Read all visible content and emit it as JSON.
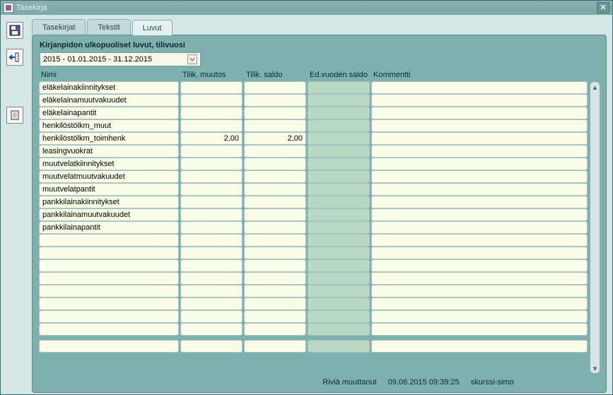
{
  "window": {
    "title": "Tasekirja"
  },
  "tabs": [
    {
      "label": "Tasekirjat",
      "active": false
    },
    {
      "label": "Tekstit",
      "active": false
    },
    {
      "label": "Luvut",
      "active": true
    }
  ],
  "panel": {
    "heading": "Kirjanpidon ulkopuoliset luvut, tilivuosi",
    "period": "2015 - 01.01.2015 - 31.12.2015",
    "columns": {
      "nimi": "Nimi",
      "muutos": "Tilik. muutos",
      "saldo": "Tilik. saldo",
      "ed": "Ed.vuoden saldo",
      "kommentti": "Kommentti"
    },
    "rows": [
      {
        "nimi": "eläkelainakiinnitykset",
        "muutos": "",
        "saldo": "",
        "ed": "",
        "kommentti": ""
      },
      {
        "nimi": "eläkelainamuutvakuudet",
        "muutos": "",
        "saldo": "",
        "ed": "",
        "kommentti": ""
      },
      {
        "nimi": "eläkelainapantit",
        "muutos": "",
        "saldo": "",
        "ed": "",
        "kommentti": ""
      },
      {
        "nimi": "henkilöstölkm_muut",
        "muutos": "",
        "saldo": "",
        "ed": "",
        "kommentti": ""
      },
      {
        "nimi": "henkilöstölkm_toimhenk",
        "muutos": "2,00",
        "saldo": "2,00",
        "ed": "",
        "kommentti": ""
      },
      {
        "nimi": "leasingvuokrat",
        "muutos": "",
        "saldo": "",
        "ed": "",
        "kommentti": ""
      },
      {
        "nimi": "muutvelatkiinnitykset",
        "muutos": "",
        "saldo": "",
        "ed": "",
        "kommentti": ""
      },
      {
        "nimi": "muutvelatmuutvakuudet",
        "muutos": "",
        "saldo": "",
        "ed": "",
        "kommentti": ""
      },
      {
        "nimi": "muutvelatpantit",
        "muutos": "",
        "saldo": "",
        "ed": "",
        "kommentti": ""
      },
      {
        "nimi": "pankkilainakiinnitykset",
        "muutos": "",
        "saldo": "",
        "ed": "",
        "kommentti": ""
      },
      {
        "nimi": "pankkilainamuutvakuudet",
        "muutos": "",
        "saldo": "",
        "ed": "",
        "kommentti": ""
      },
      {
        "nimi": "pankkilainapantit",
        "muutos": "",
        "saldo": "",
        "ed": "",
        "kommentti": ""
      },
      {
        "nimi": "",
        "muutos": "",
        "saldo": "",
        "ed": "",
        "kommentti": ""
      },
      {
        "nimi": "",
        "muutos": "",
        "saldo": "",
        "ed": "",
        "kommentti": ""
      },
      {
        "nimi": "",
        "muutos": "",
        "saldo": "",
        "ed": "",
        "kommentti": ""
      },
      {
        "nimi": "",
        "muutos": "",
        "saldo": "",
        "ed": "",
        "kommentti": ""
      },
      {
        "nimi": "",
        "muutos": "",
        "saldo": "",
        "ed": "",
        "kommentti": ""
      },
      {
        "nimi": "",
        "muutos": "",
        "saldo": "",
        "ed": "",
        "kommentti": ""
      },
      {
        "nimi": "",
        "muutos": "",
        "saldo": "",
        "ed": "",
        "kommentti": ""
      },
      {
        "nimi": "",
        "muutos": "",
        "saldo": "",
        "ed": "",
        "kommentti": ""
      },
      {
        "nimi": "",
        "muutos": "",
        "saldo": "",
        "ed": "",
        "kommentti": ""
      }
    ]
  },
  "footer": {
    "label": "Riviä muuttanut",
    "timestamp": "09.06.2015 09:39:25",
    "user": "skurssi-simo"
  }
}
